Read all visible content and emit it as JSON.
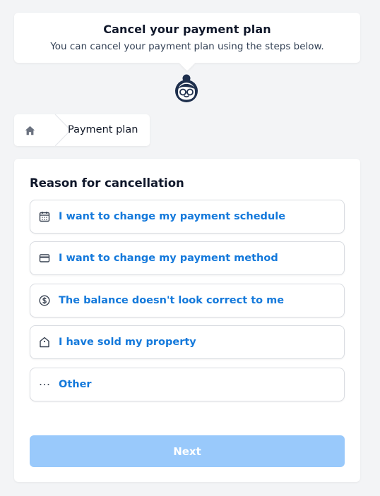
{
  "header": {
    "title": "Cancel your payment plan",
    "subtitle": "You can cancel your payment plan using the steps below."
  },
  "breadcrumb": {
    "home_icon": "home-icon",
    "current": "Payment plan"
  },
  "panel": {
    "title": "Reason for cancellation",
    "options": [
      {
        "label": "I want to change my payment schedule",
        "icon": "calendar-icon"
      },
      {
        "label": "I want to change my payment method",
        "icon": "credit-card-icon"
      },
      {
        "label": "The balance doesn't look correct to me",
        "icon": "dollar-circle-icon"
      },
      {
        "label": "I have sold my property",
        "icon": "property-tag-icon"
      },
      {
        "label": "Other",
        "icon": "ellipsis-icon"
      }
    ],
    "next_label": "Next"
  },
  "colors": {
    "accent": "#1479db",
    "button_disabled": "#99c9fb",
    "background": "#f3f4f6"
  }
}
